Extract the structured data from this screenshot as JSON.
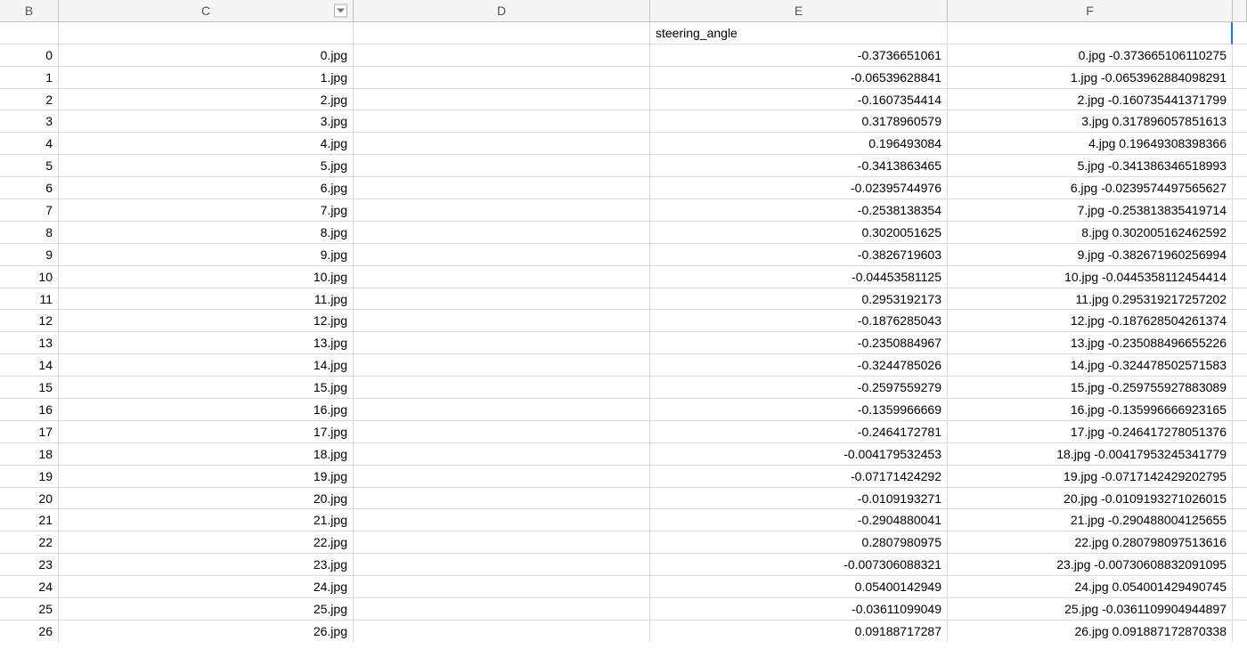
{
  "columns": {
    "B": "B",
    "C": "C",
    "D": "D",
    "E": "E",
    "F": "F"
  },
  "header_row": {
    "B": "",
    "C": "",
    "D": "",
    "E": "steering_angle",
    "F": ""
  },
  "rows": [
    {
      "B": "0",
      "C": "0.jpg",
      "D": "",
      "E": "-0.3736651061",
      "F": "0.jpg -0.373665106110275"
    },
    {
      "B": "1",
      "C": "1.jpg",
      "D": "",
      "E": "-0.06539628841",
      "F": "1.jpg -0.0653962884098291"
    },
    {
      "B": "2",
      "C": "2.jpg",
      "D": "",
      "E": "-0.1607354414",
      "F": "2.jpg -0.160735441371799"
    },
    {
      "B": "3",
      "C": "3.jpg",
      "D": "",
      "E": "0.3178960579",
      "F": "3.jpg 0.317896057851613"
    },
    {
      "B": "4",
      "C": "4.jpg",
      "D": "",
      "E": "0.196493084",
      "F": "4.jpg 0.19649308398366"
    },
    {
      "B": "5",
      "C": "5.jpg",
      "D": "",
      "E": "-0.3413863465",
      "F": "5.jpg -0.341386346518993"
    },
    {
      "B": "6",
      "C": "6.jpg",
      "D": "",
      "E": "-0.02395744976",
      "F": "6.jpg -0.0239574497565627"
    },
    {
      "B": "7",
      "C": "7.jpg",
      "D": "",
      "E": "-0.2538138354",
      "F": "7.jpg -0.253813835419714"
    },
    {
      "B": "8",
      "C": "8.jpg",
      "D": "",
      "E": "0.3020051625",
      "F": "8.jpg 0.302005162462592"
    },
    {
      "B": "9",
      "C": "9.jpg",
      "D": "",
      "E": "-0.3826719603",
      "F": "9.jpg -0.382671960256994"
    },
    {
      "B": "10",
      "C": "10.jpg",
      "D": "",
      "E": "-0.04453581125",
      "F": "10.jpg -0.0445358112454414"
    },
    {
      "B": "11",
      "C": "11.jpg",
      "D": "",
      "E": "0.2953192173",
      "F": "11.jpg 0.295319217257202"
    },
    {
      "B": "12",
      "C": "12.jpg",
      "D": "",
      "E": "-0.1876285043",
      "F": "12.jpg -0.187628504261374"
    },
    {
      "B": "13",
      "C": "13.jpg",
      "D": "",
      "E": "-0.2350884967",
      "F": "13.jpg -0.235088496655226"
    },
    {
      "B": "14",
      "C": "14.jpg",
      "D": "",
      "E": "-0.3244785026",
      "F": "14.jpg -0.324478502571583"
    },
    {
      "B": "15",
      "C": "15.jpg",
      "D": "",
      "E": "-0.2597559279",
      "F": "15.jpg -0.259755927883089"
    },
    {
      "B": "16",
      "C": "16.jpg",
      "D": "",
      "E": "-0.1359966669",
      "F": "16.jpg -0.135996666923165"
    },
    {
      "B": "17",
      "C": "17.jpg",
      "D": "",
      "E": "-0.2464172781",
      "F": "17.jpg -0.246417278051376"
    },
    {
      "B": "18",
      "C": "18.jpg",
      "D": "",
      "E": "-0.004179532453",
      "F": "18.jpg -0.00417953245341779"
    },
    {
      "B": "19",
      "C": "19.jpg",
      "D": "",
      "E": "-0.07171424292",
      "F": "19.jpg -0.0717142429202795"
    },
    {
      "B": "20",
      "C": "20.jpg",
      "D": "",
      "E": "-0.0109193271",
      "F": "20.jpg -0.0109193271026015"
    },
    {
      "B": "21",
      "C": "21.jpg",
      "D": "",
      "E": "-0.2904880041",
      "F": "21.jpg -0.290488004125655"
    },
    {
      "B": "22",
      "C": "22.jpg",
      "D": "",
      "E": "0.2807980975",
      "F": "22.jpg 0.280798097513616"
    },
    {
      "B": "23",
      "C": "23.jpg",
      "D": "",
      "E": "-0.007306088321",
      "F": "23.jpg -0.00730608832091095"
    },
    {
      "B": "24",
      "C": "24.jpg",
      "D": "",
      "E": "0.05400142949",
      "F": "24.jpg 0.054001429490745"
    },
    {
      "B": "25",
      "C": "25.jpg",
      "D": "",
      "E": "-0.03611099049",
      "F": "25.jpg -0.0361109904944897"
    },
    {
      "B": "26",
      "C": "26.jpg",
      "D": "",
      "E": "0.09188717287",
      "F": "26.jpg 0.091887172870338"
    }
  ]
}
